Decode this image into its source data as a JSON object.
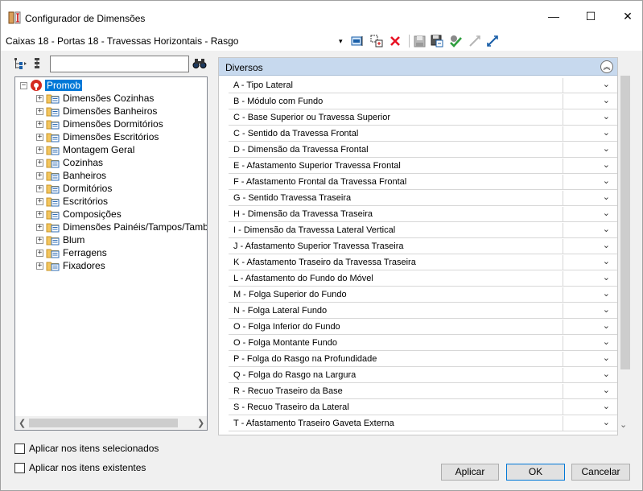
{
  "window": {
    "title": "Configurador de Dimensões",
    "minimize": "—",
    "maximize": "☐",
    "close": "✕"
  },
  "config": {
    "name": "Caixas 18 - Portas 18 - Travessas Horizontais - Rasgo",
    "dropdown_arrow": "▾"
  },
  "toolbar_icons": [
    "export-icon",
    "copy-icon",
    "delete-icon",
    "save-icon",
    "save-as-icon",
    "apply-check-icon",
    "sync-disabled-icon",
    "sync-icon"
  ],
  "tree": {
    "search_value": "",
    "root": "Promob",
    "items": [
      "Dimensões Cozinhas",
      "Dimensões Banheiros",
      "Dimensões Dormitórios",
      "Dimensões Escritórios",
      "Montagem Geral",
      "Cozinhas",
      "Banheiros",
      "Dormitórios",
      "Escritórios",
      "Composições",
      "Dimensões Painéis/Tampos/Tamburat",
      "Blum",
      "Ferragens",
      "Fixadores"
    ]
  },
  "options": {
    "selected_items": "Aplicar nos itens selecionados",
    "existing_items": "Aplicar nos itens existentes"
  },
  "properties": {
    "group": "Diversos",
    "rows": [
      "A - Tipo Lateral",
      "B - Módulo com Fundo",
      "C - Base Superior ou Travessa Superior",
      "C - Sentido da Travessa Frontal",
      "D - Dimensão da Travessa Frontal",
      "E - Afastamento Superior Travessa Frontal",
      "F - Afastamento Frontal da Travessa Frontal",
      "G - Sentido Travessa Traseira",
      "H - Dimensão da Travessa Traseira",
      "I - Dimensão da Travessa Lateral Vertical",
      "J - Afastamento Superior Travessa Traseira",
      "K - Afastamento Traseiro da Travessa Traseira",
      "L - Afastamento do Fundo do Móvel",
      "M - Folga Superior do Fundo",
      "N - Folga Lateral Fundo",
      "O - Folga Inferior do Fundo",
      "O - Folga Montante Fundo",
      "P - Folga do Rasgo na Profundidade",
      "Q - Folga do Rasgo na Largura",
      "R - Recuo Traseiro da Base",
      "S - Recuo Traseiro da Lateral",
      "T - Afastamento Traseiro Gaveta Externa"
    ]
  },
  "buttons": {
    "apply": "Aplicar",
    "ok": "OK",
    "cancel": "Cancelar"
  },
  "colors": {
    "selection": "#0078d7",
    "group_header": "#c7d9ee",
    "delete_red": "#e81123",
    "apply_green": "#2e9e3e"
  }
}
